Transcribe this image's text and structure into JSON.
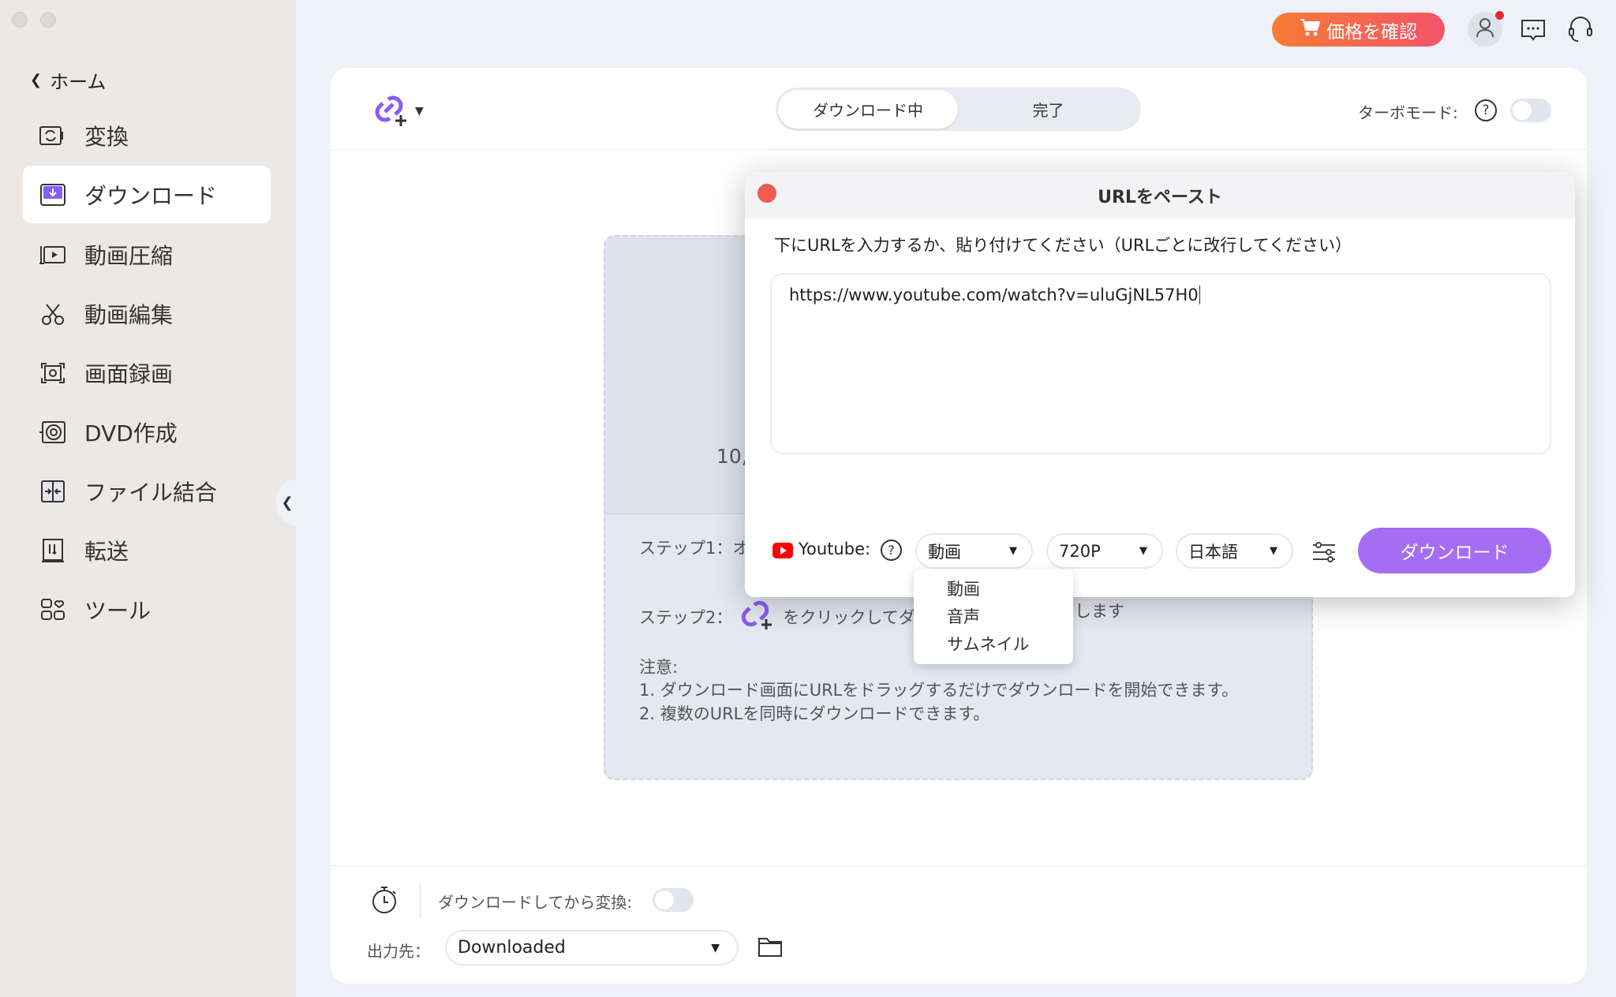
{
  "topbar": {
    "price_button": "価格を確認",
    "colors": {
      "price_start": "#f77b35",
      "price_end": "#f45369",
      "accent": "#a56ef2"
    }
  },
  "sidebar": {
    "home": "ホーム",
    "items": [
      {
        "label": "変換",
        "icon": "convert-icon"
      },
      {
        "label": "ダウンロード",
        "icon": "download-icon",
        "active": true
      },
      {
        "label": "動画圧縮",
        "icon": "compress-icon"
      },
      {
        "label": "動画編集",
        "icon": "scissors-icon"
      },
      {
        "label": "画面録画",
        "icon": "screen-record-icon"
      },
      {
        "label": "DVD作成",
        "icon": "dvd-icon"
      },
      {
        "label": "ファイル結合",
        "icon": "merge-icon"
      },
      {
        "label": "転送",
        "icon": "transfer-icon"
      },
      {
        "label": "ツール",
        "icon": "tools-icon"
      }
    ]
  },
  "main": {
    "tabs": [
      "ダウンロード中",
      "完了"
    ],
    "turbo_label": "ターボモード:",
    "turbo_on": false,
    "bg_partial": "10,",
    "step1": "ステップ1：オ",
    "step2_prefix": "ステップ2：",
    "step2_text": "をクリックしてダ",
    "step2_suffix": "ーストします",
    "note_title": "注意:",
    "note1": "1. ダウンロード画面にURLをドラッグするだけでダウンロードを開始できます。",
    "note2": "2. 複数のURLを同時にダウンロードできます。",
    "convert_label": "ダウンロードしてから変換:",
    "convert_on": false,
    "output_label": "出力先：",
    "output_value": "Downloaded"
  },
  "dialog": {
    "title": "URLをペースト",
    "instruction": "下にURLを入力するか、貼り付けてください（URLごとに改行してください）",
    "url": "https://www.youtube.com/watch?v=uluGjNL57H0",
    "site": "Youtube:",
    "type_value": "動画",
    "quality_value": "720P",
    "language_value": "日本語",
    "download_button": "ダウンロード",
    "type_options": [
      "動画",
      "音声",
      "サムネイル"
    ]
  }
}
